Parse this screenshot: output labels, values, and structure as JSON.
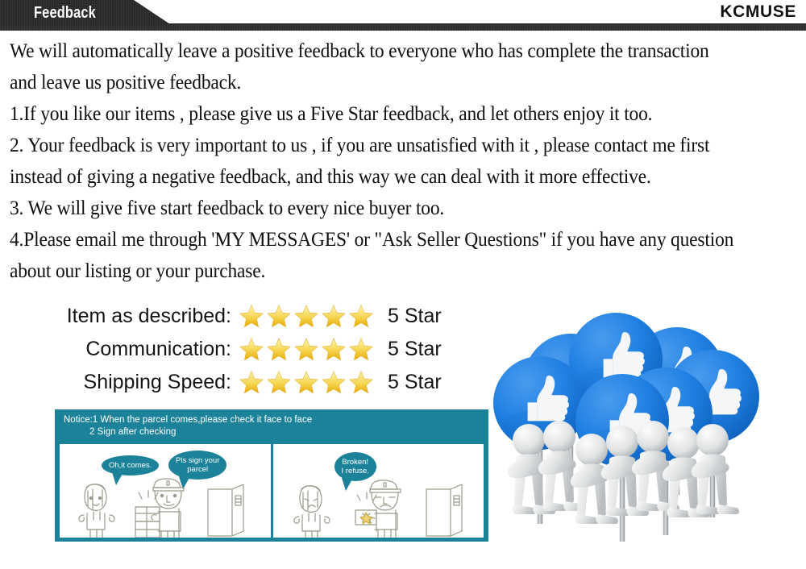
{
  "header": {
    "tab_label": "Feedback",
    "brand": "KCMUSE",
    "tab_bg": "#252525",
    "strip_bg": "#2b2b2b"
  },
  "policy": {
    "lines": [
      "We will automatically  leave a positive feedback to everyone who has  complete the transaction",
      "and leave us positive  feedback.",
      "1.If you like our items , please give us a Five Star feedback, and let others enjoy it too.",
      "2. Your feedback is very important to us , if you are unsatisfied with it , please contact me first",
      "instead of giving a negative feedback, and this way we can deal with it more effective.",
      "3. We will give five start feedback to every nice buyer too.",
      "4.Please email me through 'MY MESSAGES' or \"Ask  Seller Questions\" if you have any question",
      "about our  listing or your purchase."
    ]
  },
  "ratings": {
    "star_count": 5,
    "star_color_top": "#fdf3a0",
    "star_color_bottom": "#eeb90c",
    "rows": [
      {
        "label": "Item as described:",
        "value": "5 Star",
        "stars": 5
      },
      {
        "label": "Communication:",
        "value": "5 Star",
        "stars": 5
      },
      {
        "label": "Shipping Speed:",
        "value": "5 Star",
        "stars": 5
      }
    ]
  },
  "notice": {
    "accent_color": "#1b8299",
    "header_line1": "Notice:1 When the parcel comes,please check it face to face",
    "header_line2": "2 Sign after checking",
    "panels": [
      {
        "name": "accept-panel",
        "bubbles": [
          {
            "text": "Oh,it comes."
          },
          {
            "text": "Pls sign your\nparcel"
          }
        ]
      },
      {
        "name": "refuse-panel",
        "bubbles": [
          {
            "text": "Broken!\nI refuse."
          }
        ]
      }
    ]
  },
  "thumbs_image": {
    "alt": "crowd of 3d figures holding blue thumbs-up signs",
    "sign_color": "#1b7fe0",
    "figure_color": "#d7d9da",
    "thumb_color": "#f2f4f5"
  }
}
